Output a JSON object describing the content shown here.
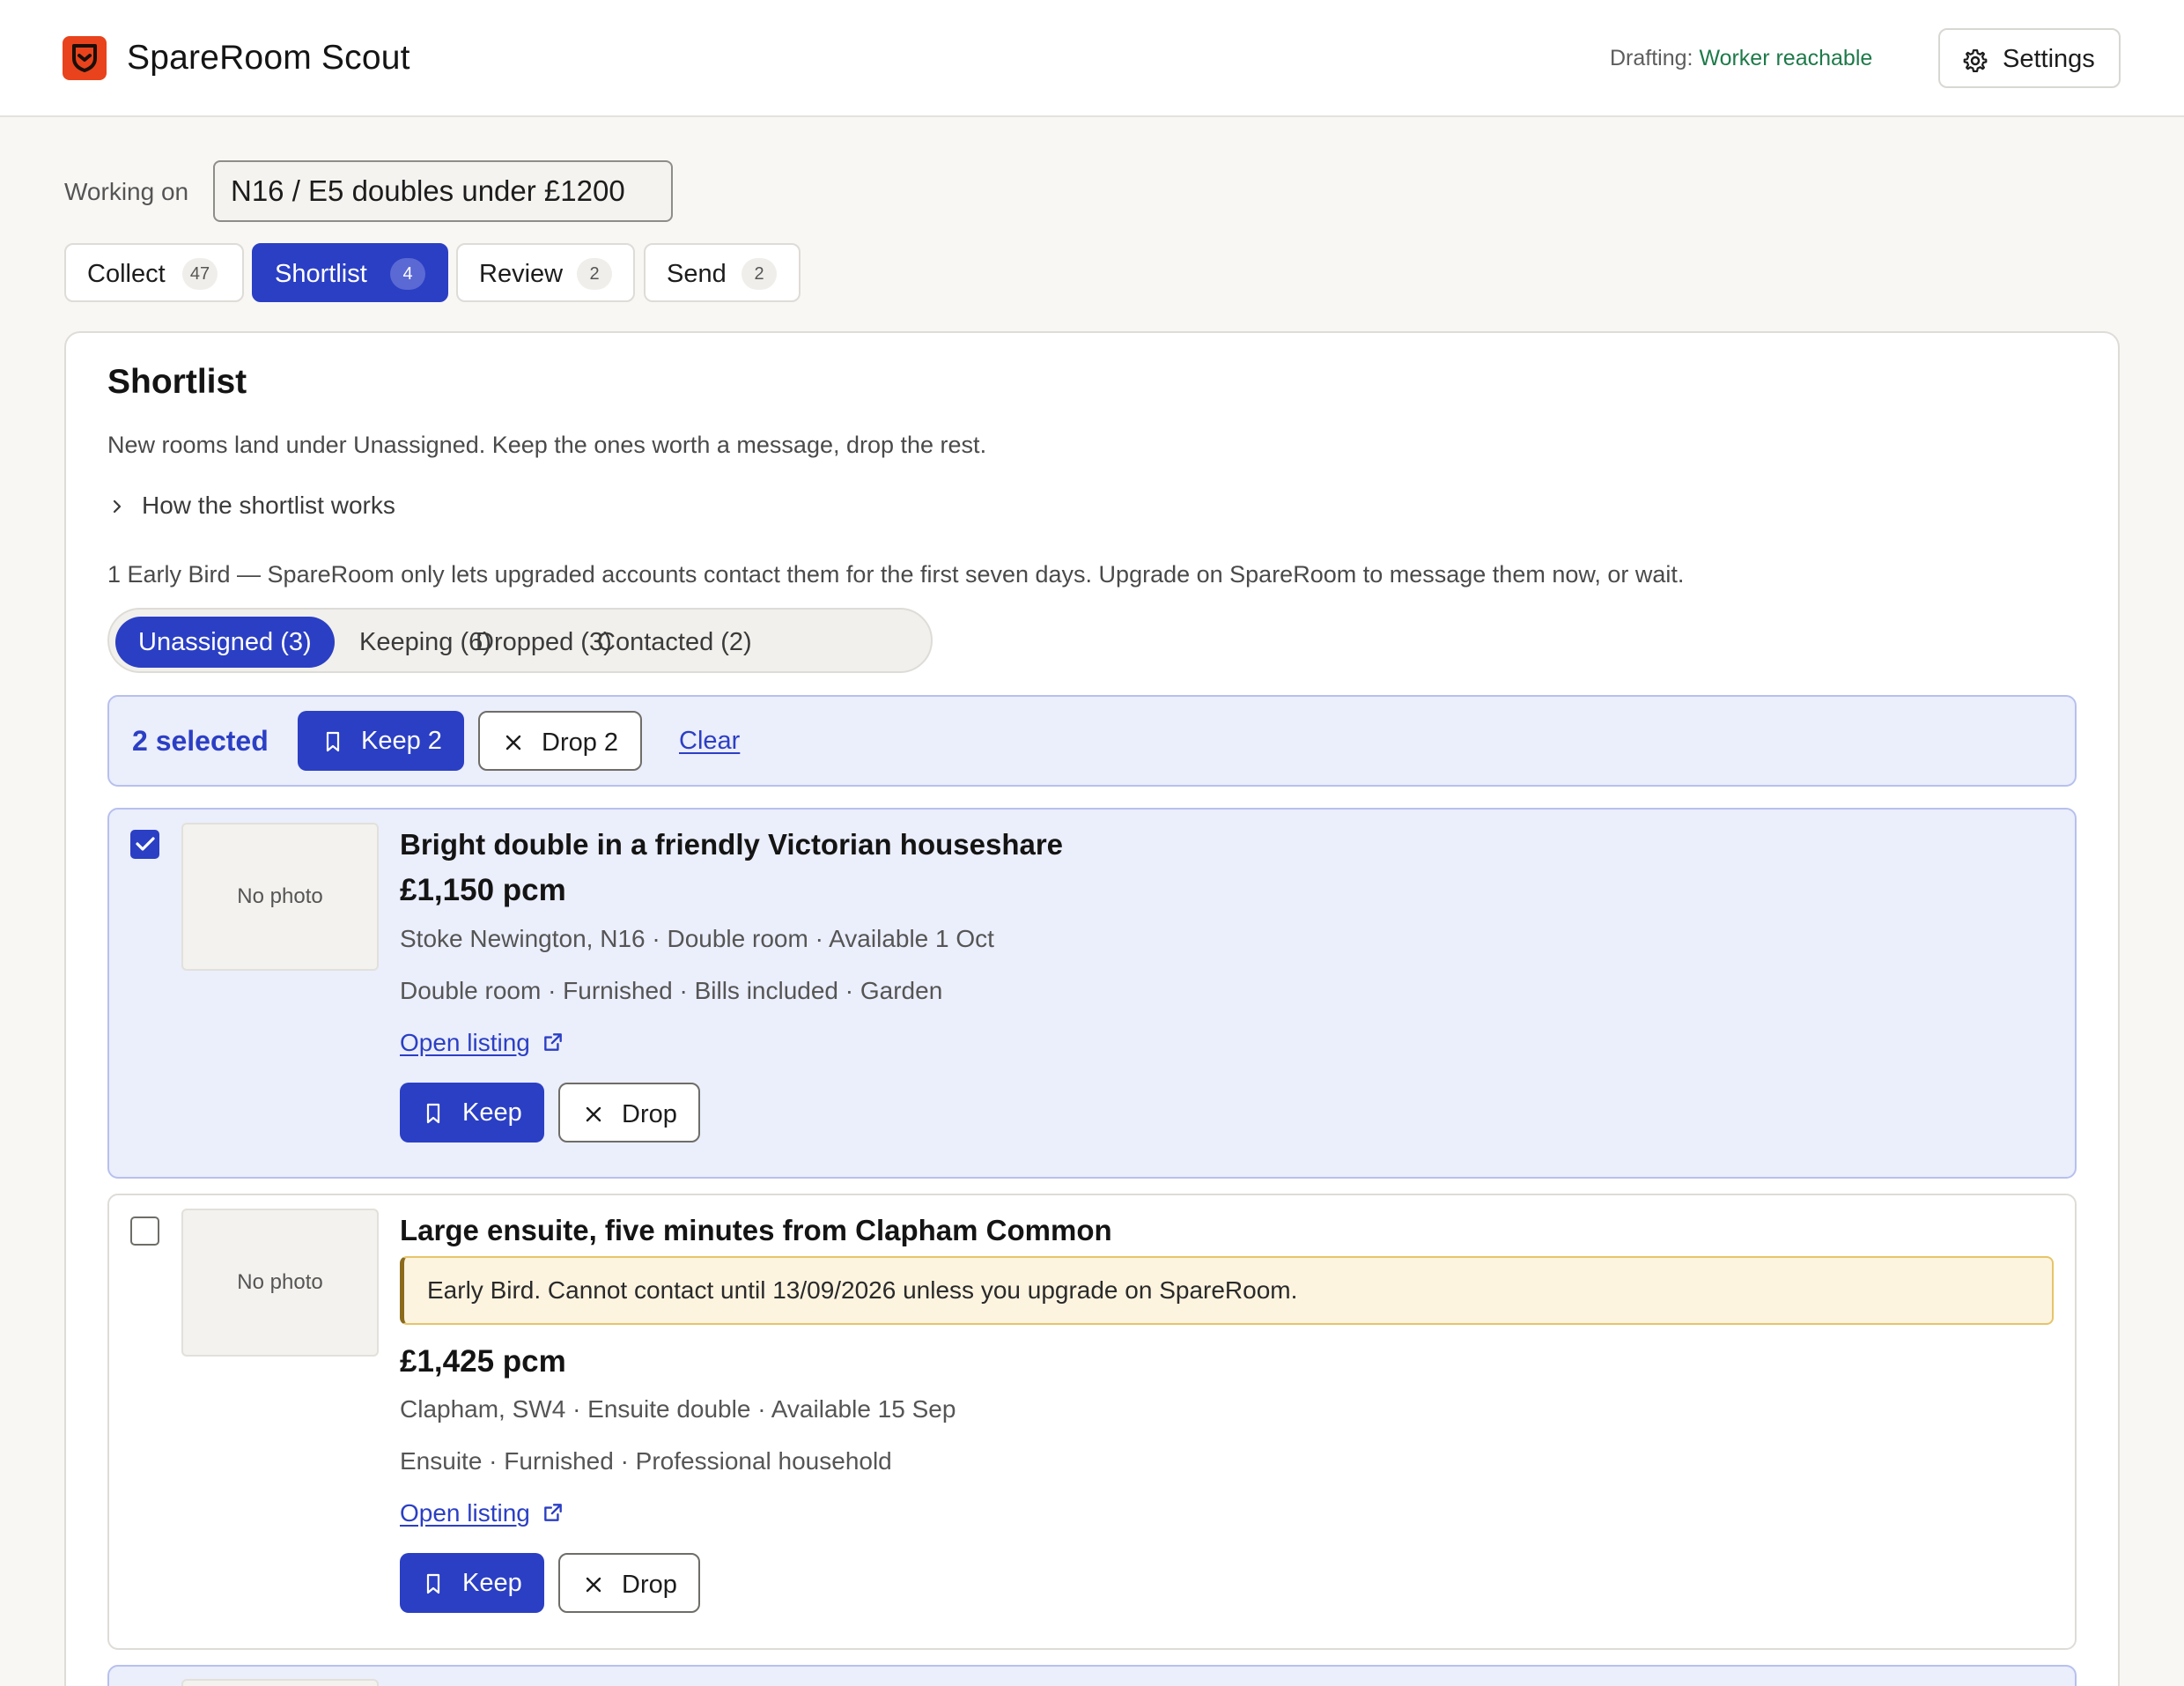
{
  "app": {
    "title": "SpareRoom Scout",
    "drafting_label": "Drafting:",
    "drafting_status": "Worker reachable",
    "settings_label": "Settings"
  },
  "working": {
    "label": "Working on",
    "value": "N16 / E5 doubles under £1200"
  },
  "steps": [
    {
      "label": "Collect",
      "count": "47"
    },
    {
      "label": "Shortlist",
      "count": "4",
      "active": true
    },
    {
      "label": "Review",
      "count": "2"
    },
    {
      "label": "Send",
      "count": "2"
    }
  ],
  "shortlist": {
    "heading": "Shortlist",
    "description": "New rooms land under Unassigned. Keep the ones worth a message, drop the rest.",
    "how_label": "How the shortlist works",
    "early_bird_note": "1 Early Bird — SpareRoom only lets upgraded accounts contact them for the first seven days. Upgrade on SpareRoom to message them now, or wait."
  },
  "filters": [
    {
      "label": "Unassigned (3)",
      "active": true
    },
    {
      "label": "Keeping (6)"
    },
    {
      "label": "Dropped (3)"
    },
    {
      "label": "Contacted (2)"
    }
  ],
  "selection": {
    "count_label": "2 selected",
    "keep_label": "Keep 2",
    "drop_label": "Drop 2",
    "clear_label": "Clear"
  },
  "listings": [
    {
      "selected": true,
      "photo_label": "No photo",
      "title": "Bright double in a friendly Victorian houseshare",
      "price": "£1,150 pcm",
      "location": "Stoke Newington, N16 · Double room · Available 1 Oct",
      "features": "Double room · Furnished · Bills included · Garden",
      "link_label": "Open listing",
      "keep_label": "Keep",
      "drop_label": "Drop"
    },
    {
      "selected": false,
      "photo_label": "No photo",
      "title": "Large ensuite, five minutes from Clapham Common",
      "warning": "Early Bird. Cannot contact until 13/09/2026 unless you upgrade on SpareRoom.",
      "price": "£1,425 pcm",
      "location": "Clapham, SW4 · Ensuite double · Available 15 Sep",
      "features": "Ensuite · Furnished · Professional household",
      "link_label": "Open listing",
      "keep_label": "Keep",
      "drop_label": "Drop"
    }
  ],
  "colors": {
    "accent": "#2b3fc4",
    "brand": "#e8431c",
    "status_ok": "#1e7a4a",
    "warning_bg": "#fdf4e0"
  },
  "icons": [
    "shield-logo-icon",
    "gear-icon",
    "chevron-right-icon",
    "bookmark-icon",
    "close-icon",
    "external-link-icon",
    "check-icon"
  ]
}
